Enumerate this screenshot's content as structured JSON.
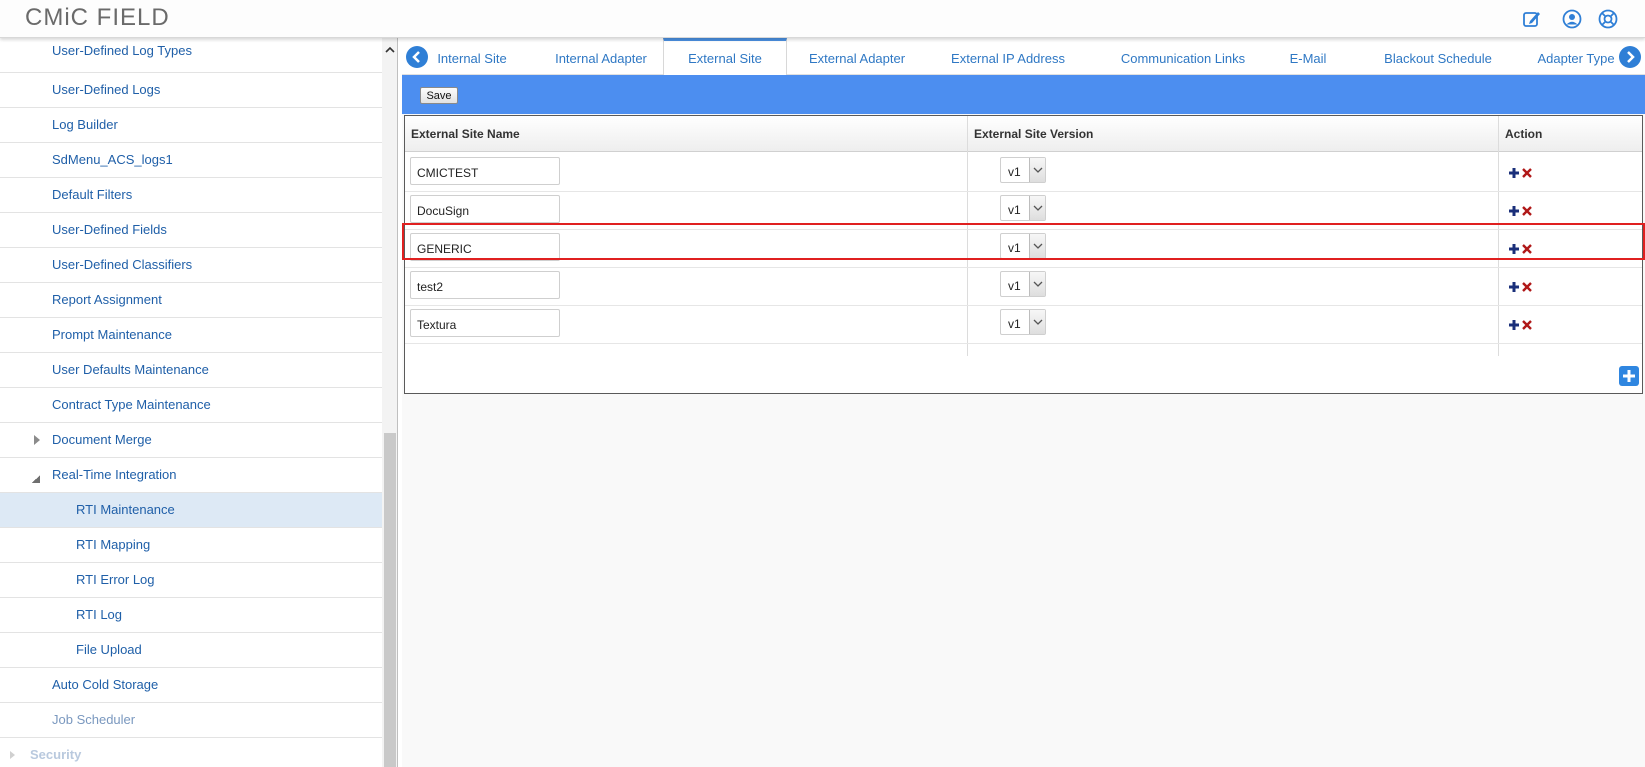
{
  "app": {
    "title": "CMiC FIELD"
  },
  "header": {
    "icons": [
      "edit-icon",
      "user-account-icon",
      "help-lifebuoy-icon"
    ]
  },
  "sidebar": {
    "items": [
      {
        "label": "User-Defined Log Types",
        "level": 1
      },
      {
        "label": "User-Defined Logs",
        "level": 1
      },
      {
        "label": "Log Builder",
        "level": 1
      },
      {
        "label": "SdMenu_ACS_logs1",
        "level": 1
      },
      {
        "label": "Default Filters",
        "level": 1
      },
      {
        "label": "User-Defined Fields",
        "level": 1
      },
      {
        "label": "User-Defined Classifiers",
        "level": 1
      },
      {
        "label": "Report Assignment",
        "level": 1
      },
      {
        "label": "Prompt Maintenance",
        "level": 1
      },
      {
        "label": "User Defaults Maintenance",
        "level": 1
      },
      {
        "label": "Contract Type Maintenance",
        "level": 1
      },
      {
        "label": "Document Merge",
        "level": 1,
        "expander": "collapsed"
      },
      {
        "label": "Real-Time Integration",
        "level": 1,
        "expander": "expanded"
      },
      {
        "label": "RTI Maintenance",
        "level": 2,
        "selected": true
      },
      {
        "label": "RTI Mapping",
        "level": 2
      },
      {
        "label": "RTI Error Log",
        "level": 2
      },
      {
        "label": "RTI Log",
        "level": 2
      },
      {
        "label": "File Upload",
        "level": 2
      },
      {
        "label": "Auto Cold Storage",
        "level": 1
      },
      {
        "label": "Job Scheduler",
        "level": 1
      },
      {
        "label": "Security",
        "level": 0
      }
    ]
  },
  "tabs": {
    "items": [
      "Internal Site",
      "Internal Adapter",
      "External Site",
      "External Adapter",
      "External IP Address",
      "Communication Links",
      "E-Mail",
      "Blackout Schedule",
      "Adapter Type"
    ],
    "active": "External Site"
  },
  "toolbar": {
    "save_label": "Save"
  },
  "grid": {
    "columns": [
      "External Site Name",
      "External Site Version",
      "Action"
    ],
    "rows": [
      {
        "name": "CMICTEST",
        "version": "v1"
      },
      {
        "name": "DocuSign",
        "version": "v1"
      },
      {
        "name": "GENERIC",
        "version": "v1",
        "highlighted": true
      },
      {
        "name": "test2",
        "version": "v1"
      },
      {
        "name": "Textura",
        "version": "v1"
      }
    ]
  },
  "colors": {
    "toolbar_blue": "#4c8ef0",
    "link_blue": "#1f5fa8",
    "tab_blue": "#2f78c4",
    "highlight_red": "#e02020",
    "add_icon": "#1a2f7a",
    "delete_icon": "#b01818"
  }
}
